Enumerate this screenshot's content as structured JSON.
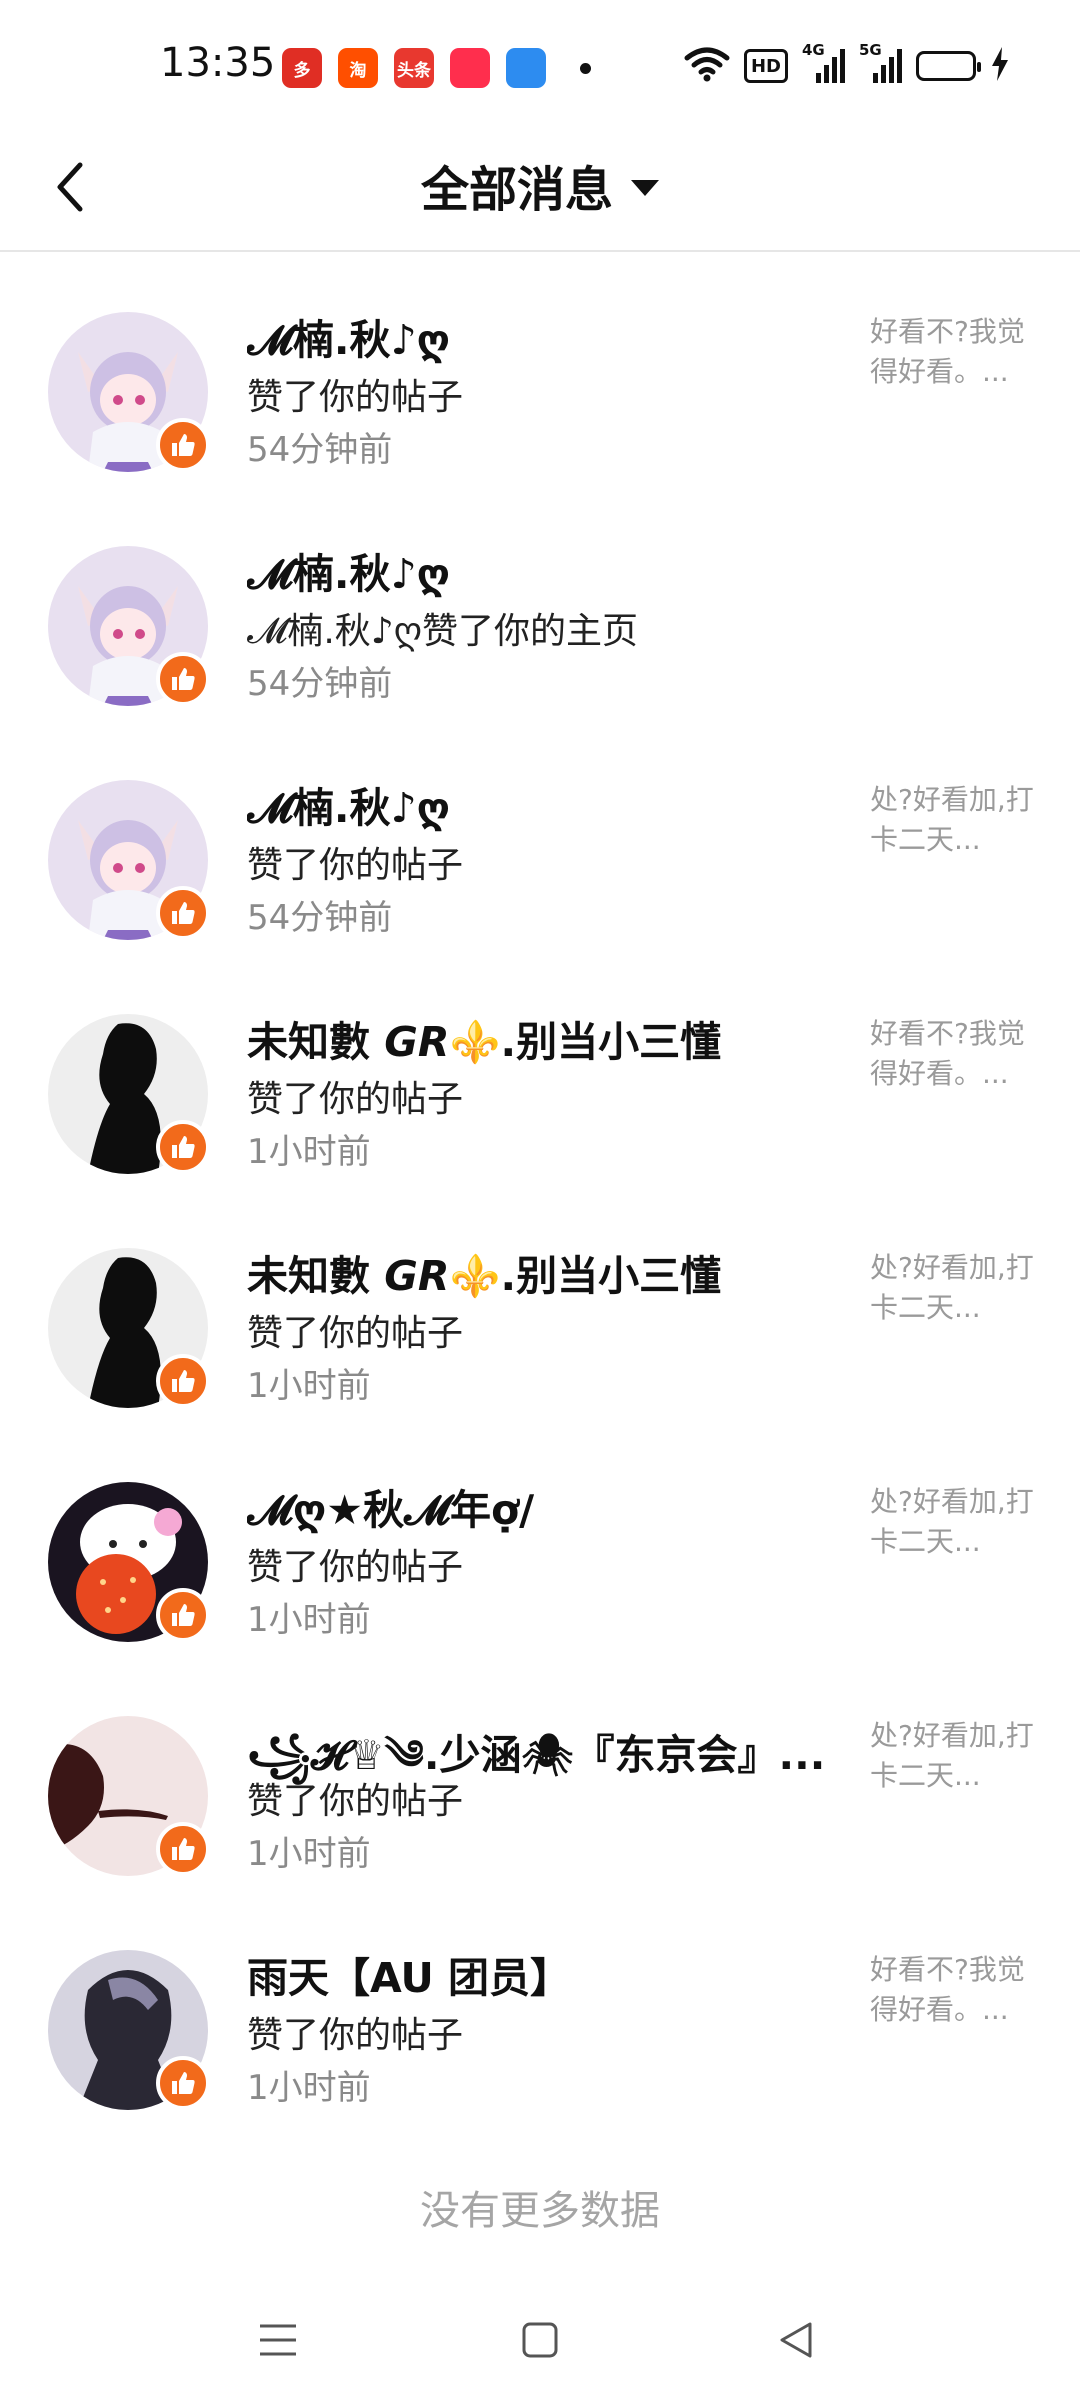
{
  "status_bar": {
    "time": "13:35",
    "apps": [
      {
        "icon": "pinduoduo-icon",
        "label": "多",
        "color": "#e02e24"
      },
      {
        "icon": "taobao-icon",
        "label": "淘",
        "color": "#ff4f00"
      },
      {
        "icon": "toutiao-icon",
        "label": "头条",
        "color": "#e8382f"
      },
      {
        "icon": "location-app-icon",
        "label": "",
        "color": "#ff2e4d"
      },
      {
        "icon": "blue-app-icon",
        "label": "",
        "color": "#2d8cf0"
      }
    ],
    "hd_label": "HD",
    "signal_4g_label": "4G",
    "signal_5g_label": "5G"
  },
  "header": {
    "title": "全部消息"
  },
  "messages": [
    {
      "name": "𝓜楠.秋♪ღ",
      "action": "赞了你的帖子",
      "time": "54分钟前",
      "preview": "好看不?我觉得好看。...",
      "avatar": "anime"
    },
    {
      "name": "𝓜楠.秋♪ღ",
      "action": "𝓜楠.秋♪ღ赞了你的主页",
      "time": "54分钟前",
      "preview": "",
      "avatar": "anime"
    },
    {
      "name": "𝓜楠.秋♪ღ",
      "action": "赞了你的帖子",
      "time": "54分钟前",
      "preview": "处?好看加,打卡二天...",
      "avatar": "anime"
    },
    {
      "name": "未知數 𝙂𝙍⚜️.别当小三懂",
      "action": "赞了你的帖子",
      "time": "1小时前",
      "preview": "好看不?我觉得好看。...",
      "avatar": "silhouette"
    },
    {
      "name": "未知數 𝙂𝙍⚜️.别当小三懂",
      "action": "赞了你的帖子",
      "time": "1小时前",
      "preview": "处?好看加,打卡二天...",
      "avatar": "silhouette"
    },
    {
      "name": "𝓜ღ★秋𝓜年ợ/",
      "action": "赞了你的帖子",
      "time": "1小时前",
      "preview": "处?好看加,打卡二天...",
      "avatar": "kitty"
    },
    {
      "name": "꧁𝓗♕༄.少涵🕷『东京会』...",
      "action": "赞了你的帖子",
      "time": "1小时前",
      "preview": "处?好看加,打卡二天...",
      "avatar": "shadow"
    },
    {
      "name": "雨天【AU 团员】",
      "action": "赞了你的帖子",
      "time": "1小时前",
      "preview": "好看不?我觉得好看。...",
      "avatar": "dark"
    }
  ],
  "footer_note": "没有更多数据",
  "colors": {
    "like_badge": "#f26a1b",
    "secondary_text": "#8a8a8a"
  }
}
